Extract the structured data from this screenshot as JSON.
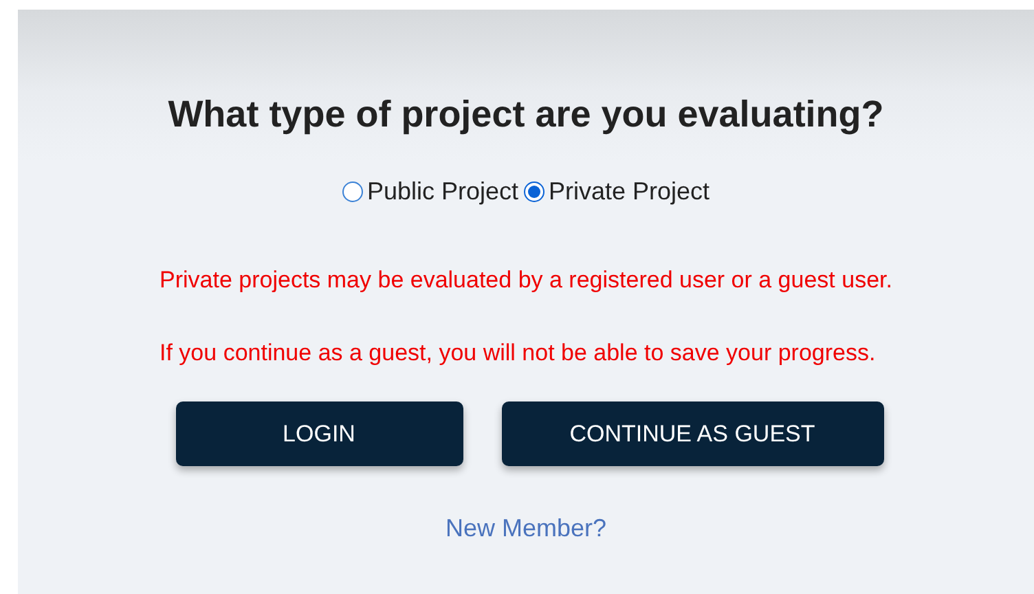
{
  "title": "What type of project are you evaluating?",
  "options": [
    {
      "label": "Public Project",
      "selected": false
    },
    {
      "label": "Private Project",
      "selected": true
    }
  ],
  "notices": [
    "Private projects may be evaluated by a registered user or a guest user.",
    "If you continue as a guest, you will not be able to save your progress."
  ],
  "buttons": [
    {
      "label": "LOGIN"
    },
    {
      "label": "CONTINUE AS GUEST"
    }
  ],
  "link": "New Member?"
}
